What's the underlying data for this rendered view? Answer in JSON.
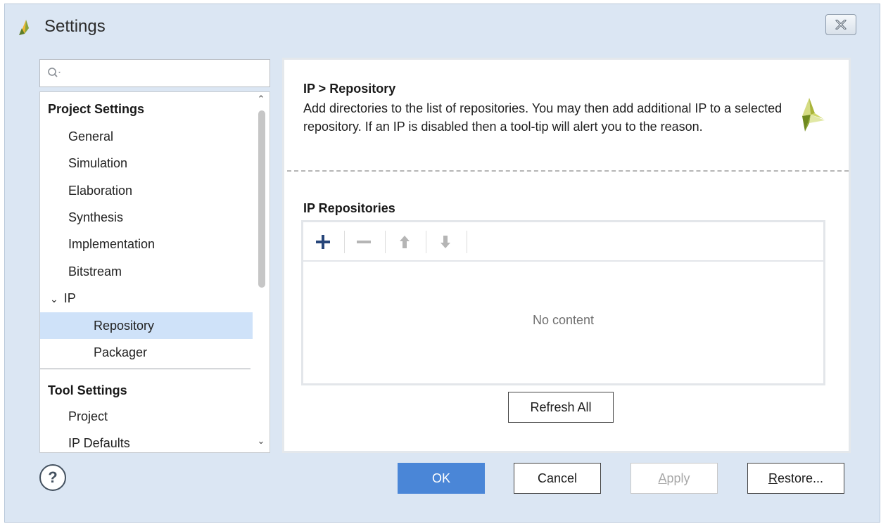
{
  "window": {
    "title": "Settings"
  },
  "search": {
    "placeholder": "",
    "value": ""
  },
  "tree": {
    "project_settings_label": "Project Settings",
    "project_items": [
      "General",
      "Simulation",
      "Elaboration",
      "Synthesis",
      "Implementation",
      "Bitstream"
    ],
    "ip_label": "IP",
    "ip_children": [
      "Repository",
      "Packager"
    ],
    "selected": "Repository",
    "tool_settings_label": "Tool Settings",
    "tool_items": [
      "Project",
      "IP Defaults"
    ]
  },
  "page": {
    "breadcrumb": "IP > Repository",
    "description": "Add directories to the list of repositories. You may then add additional IP to a selected repository. If an IP is disabled then a tool-tip will alert you to the reason.",
    "section_title": "IP Repositories",
    "empty_message": "No content",
    "refresh_label": "Refresh All"
  },
  "buttons": {
    "help": "?",
    "ok": "OK",
    "cancel": "Cancel",
    "apply_prefix": "A",
    "apply_rest": "pply",
    "restore_prefix": "R",
    "restore_rest": "estore..."
  },
  "colors": {
    "accent": "#4a86d7",
    "selection": "#cfe2f9",
    "window_bg": "#dbe6f3"
  }
}
